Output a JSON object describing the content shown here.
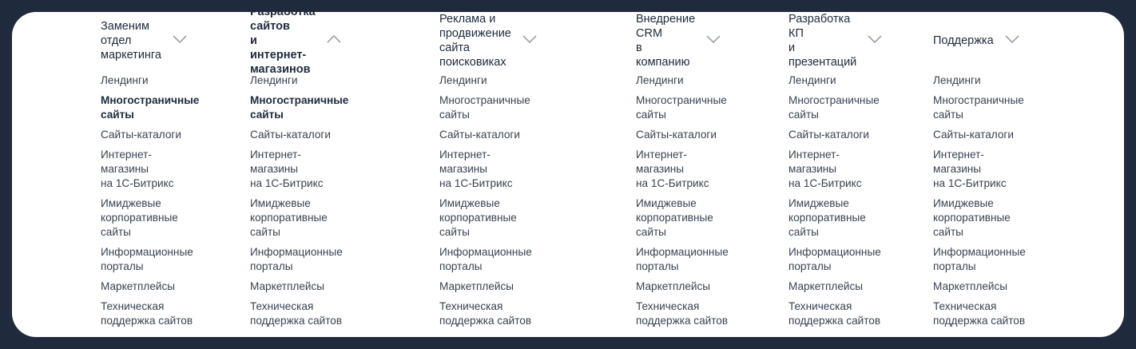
{
  "columns": [
    {
      "title": "Заменим отдел\nмаркетинга",
      "expanded": false,
      "items": [
        "Лендинги",
        "Многостраничные\nсайты",
        "Сайты-каталоги",
        "Интернет-магазины\nна 1С-Битрикс",
        "Имиджевые\nкорпоративные\nсайты",
        "Информационные\nпорталы",
        "Маркетплейсы",
        "Техническая\nподдержка сайтов"
      ]
    },
    {
      "title": "Разработка сайтов\nи интернет-магазинов",
      "expanded": true,
      "items": [
        "Лендинги",
        "Многостраничные\nсайты",
        "Сайты-каталоги",
        "Интернет-магазины\nна 1С-Битрикс",
        "Имиджевые\nкорпоративные\nсайты",
        "Информационные\nпорталы",
        "Маркетплейсы",
        "Техническая\nподдержка сайтов"
      ]
    },
    {
      "title": "Реклама и продвижение\nсайта поисковиках",
      "expanded": false,
      "items": [
        "Лендинги",
        "Многостраничные\nсайты",
        "Сайты-каталоги",
        "Интернет-магазины\nна 1С-Битрикс",
        "Имиджевые\nкорпоративные\nсайты",
        "Информационные\nпорталы",
        "Маркетплейсы",
        "Техническая\nподдержка сайтов"
      ]
    },
    {
      "title": "Внедрение CRM\nв компанию",
      "expanded": false,
      "items": [
        "Лендинги",
        "Многостраничные\nсайты",
        "Сайты-каталоги",
        "Интернет-магазины\nна 1С-Битрикс",
        "Имиджевые\nкорпоративные\nсайты",
        "Информационные\nпорталы",
        "Маркетплейсы",
        "Техническая\nподдержка сайтов"
      ]
    },
    {
      "title": "Разработка КП\nи презентаций",
      "expanded": false,
      "items": [
        "Лендинги",
        "Многостраничные\nсайты",
        "Сайты-каталоги",
        "Интернет-магазины\nна 1С-Битрикс",
        "Имиджевые\nкорпоративные\nсайты",
        "Информационные\nпорталы",
        "Маркетплейсы",
        "Техническая\nподдержка сайтов"
      ]
    },
    {
      "title": "Поддержка",
      "expanded": false,
      "items": [
        "Лендинги",
        "Многостраничные\nсайты",
        "Сайты-каталоги",
        "Интернет-магазины\nна 1С-Битрикс",
        "Имиджевые\nкорпоративные\nсайты",
        "Информационные\nпорталы",
        "Маркетплейсы",
        "Техническая\nподдержка сайтов"
      ]
    }
  ],
  "highlighted_item": "Многостраничные\nсайты",
  "colors": {
    "frame": "#1f2a3c",
    "panel": "#ffffff",
    "text_primary": "#1f2a3c",
    "text_item": "#3a4250",
    "chevron": "#9aa1ab"
  },
  "icons": {
    "collapsed": "chevron-down-icon",
    "expanded": "chevron-up-icon"
  }
}
